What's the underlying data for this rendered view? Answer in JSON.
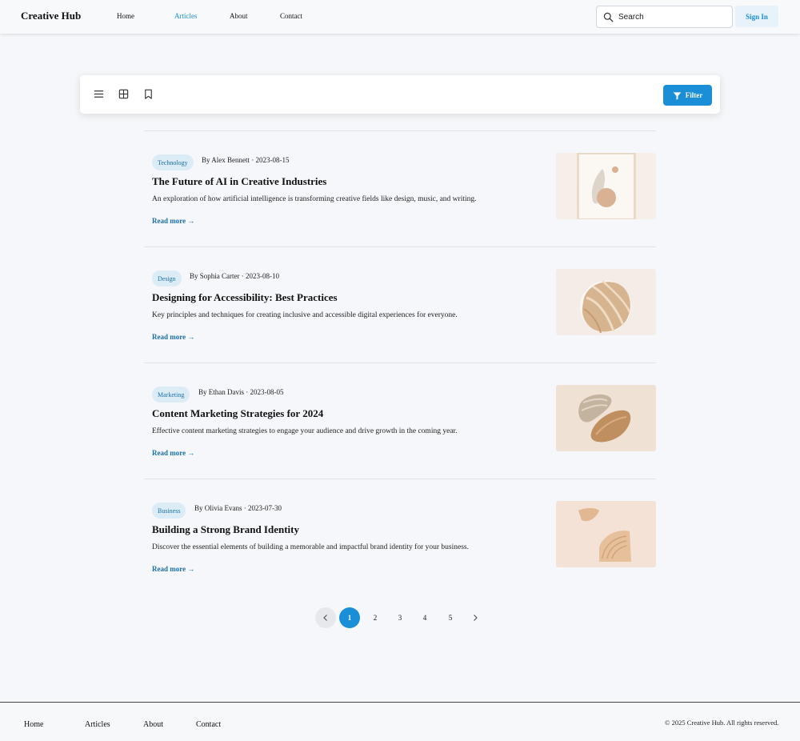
{
  "header": {
    "brand": "Creative Hub",
    "nav": [
      "Home",
      "Articles",
      "About",
      "Contact"
    ],
    "active_nav": "Articles",
    "search_placeholder": "Search",
    "signin_label": "Sign In"
  },
  "toolbar": {
    "icons": [
      "list-view-icon",
      "grid-view-icon",
      "bookmark-icon",
      "filter-icon"
    ],
    "filter_label": "Filter"
  },
  "articles": [
    {
      "category": "Technology",
      "meta": "By Alex Bennett · 2023-08-15",
      "title": "The Future of AI in Creative Industries",
      "excerpt": "An exploration of how artificial intelligence is transforming creative fields like design, music, and writing.",
      "read_more": "Read more →"
    },
    {
      "category": "Design",
      "meta": "By Sophia Carter · 2023-08-10",
      "title": "Designing for Accessibility: Best Practices",
      "excerpt": "Key principles and techniques for creating inclusive and accessible digital experiences for everyone.",
      "read_more": "Read more →"
    },
    {
      "category": "Marketing",
      "meta": "By Ethan Davis · 2023-08-05",
      "title": "Content Marketing Strategies for 2024",
      "excerpt": "Effective content marketing strategies to engage your audience and drive growth in the coming year.",
      "read_more": "Read more →"
    },
    {
      "category": "Business",
      "meta": "By Olivia Evans · 2023-07-30",
      "title": "Building a Strong Brand Identity",
      "excerpt": "Discover the essential elements of building a memorable and impactful brand identity for your business.",
      "read_more": "Read more →"
    }
  ],
  "pagination": {
    "pages": [
      "1",
      "2",
      "3",
      "4",
      "5"
    ],
    "current": "1"
  },
  "footer": {
    "links": [
      "Home",
      "Articles",
      "About",
      "Contact"
    ],
    "copyright": "© 2025 Creative Hub. All rights reserved."
  },
  "colors": {
    "accent": "#1a8fd8",
    "background": "#f5f7fa",
    "badge_bg": "#dcecf7"
  }
}
